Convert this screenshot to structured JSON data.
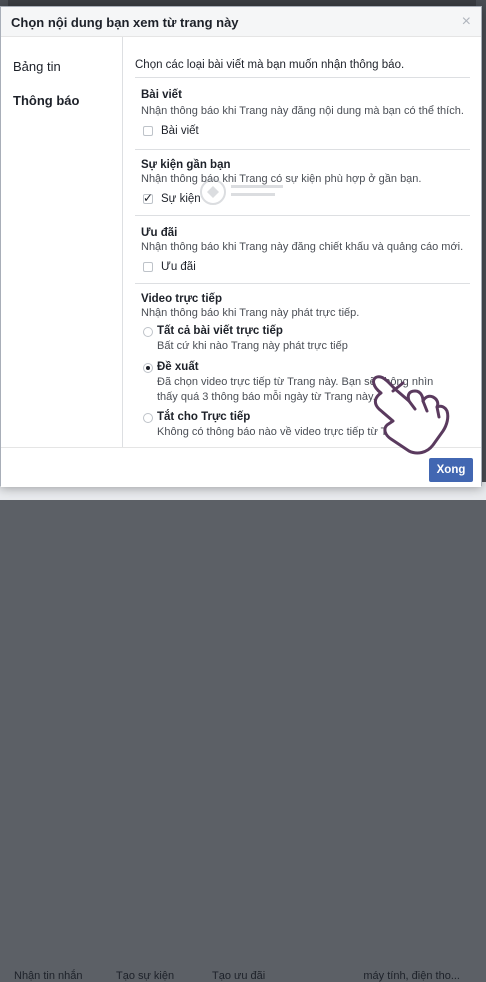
{
  "background": {
    "tabs": [
      "Nhận tin nhắn",
      "Tạo sự kiện",
      "Tạo ưu đãi"
    ],
    "extra_text": "máy tính, điện tho..."
  },
  "dialog": {
    "title": "Chọn nội dung bạn xem từ trang này",
    "close_icon": "close-icon"
  },
  "sidebar": {
    "items": [
      {
        "label": "Bảng tin",
        "active": false
      },
      {
        "label": "Thông báo",
        "active": true
      }
    ]
  },
  "main": {
    "intro": "Chọn các loại bài viết mà bạn muốn nhận thông báo.",
    "sections": [
      {
        "title": "Bài viết",
        "desc": "Nhận thông báo khi Trang này đăng nội dung mà bạn có thể thích.",
        "option": {
          "label": "Bài viết",
          "checked": false
        }
      },
      {
        "title": "Sự kiện gần bạn",
        "desc": "Nhận thông báo khi Trang có sự kiện phù hợp ở gần bạn.",
        "option": {
          "label": "Sự kiện",
          "checked": true
        }
      },
      {
        "title": "Ưu đãi",
        "desc": "Nhận thông báo khi Trang này đăng chiết khấu và quảng cáo mới.",
        "option": {
          "label": "Ưu đãi",
          "checked": false
        }
      }
    ],
    "video": {
      "title": "Video trực tiếp",
      "desc": "Nhận thông báo khi Trang này phát trực tiếp.",
      "options": [
        {
          "label": "Tất cả bài viết trực tiếp",
          "desc": "Bất cứ khi nào Trang này phát trực tiếp",
          "selected": false
        },
        {
          "label": "Đề xuất",
          "desc": "Đã chọn video trực tiếp từ Trang này. Bạn sẽ không nhìn thấy quá 3 thông báo mỗi ngày từ Trang này.",
          "selected": true
        },
        {
          "label": "Tắt cho Trực tiếp",
          "desc": "Không có thông báo nào về video trực tiếp từ Trang này",
          "selected": false
        }
      ]
    }
  },
  "footer": {
    "done_label": "Xong",
    "done_color": "#4267b2"
  }
}
